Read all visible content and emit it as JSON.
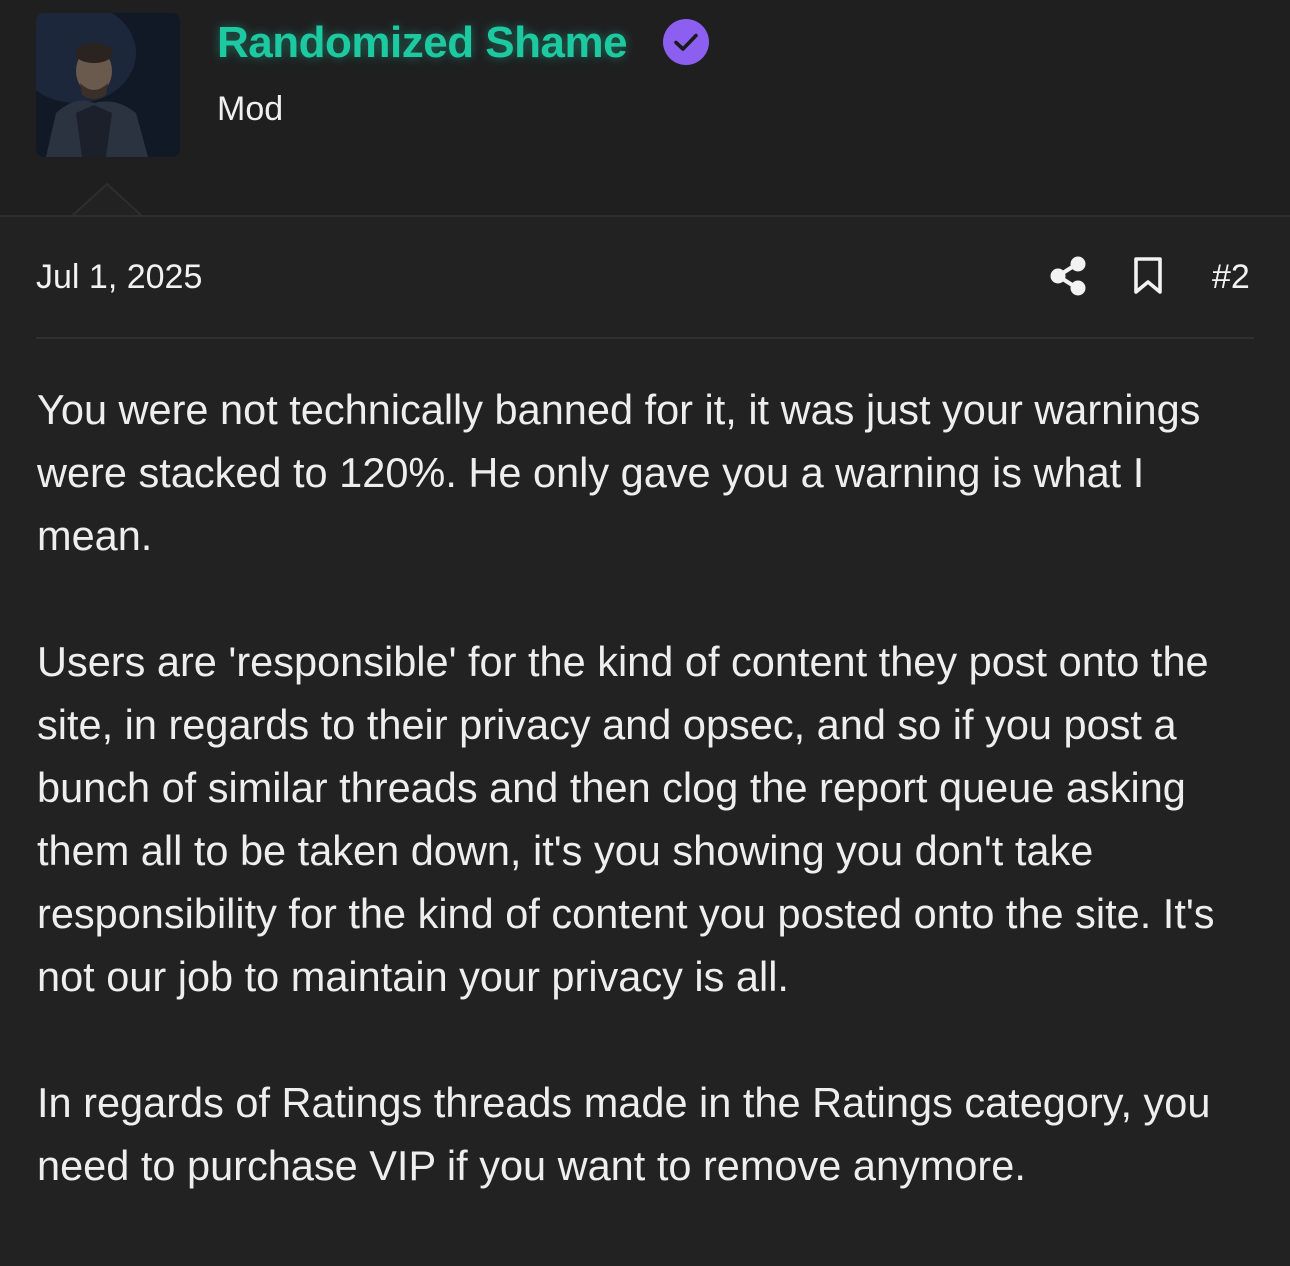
{
  "user": {
    "name": "Randomized Shame",
    "role": "Mod",
    "verified": true,
    "name_color": "#1dc9a1",
    "badge_color": "#8c5ff0"
  },
  "post": {
    "date": "Jul 1, 2025",
    "number": "#2",
    "actions": [
      "share-icon",
      "bookmark-icon"
    ],
    "paragraphs": [
      "You were not technically banned for it, it was just your warnings were stacked to 120%. He only gave you a warning is what I mean.",
      "Users are 'responsible' for the kind of content they post onto the site, in regards to their privacy and opsec, and so if you post a bunch of similar threads and then clog the report queue asking them all to be taken down, it's you showing you don't take responsibility for the kind of content you posted onto the site. It's not our job to maintain your privacy is all.",
      "In regards of Ratings threads made in the Ratings category, you need to purchase VIP if you want to remove anymore."
    ]
  }
}
